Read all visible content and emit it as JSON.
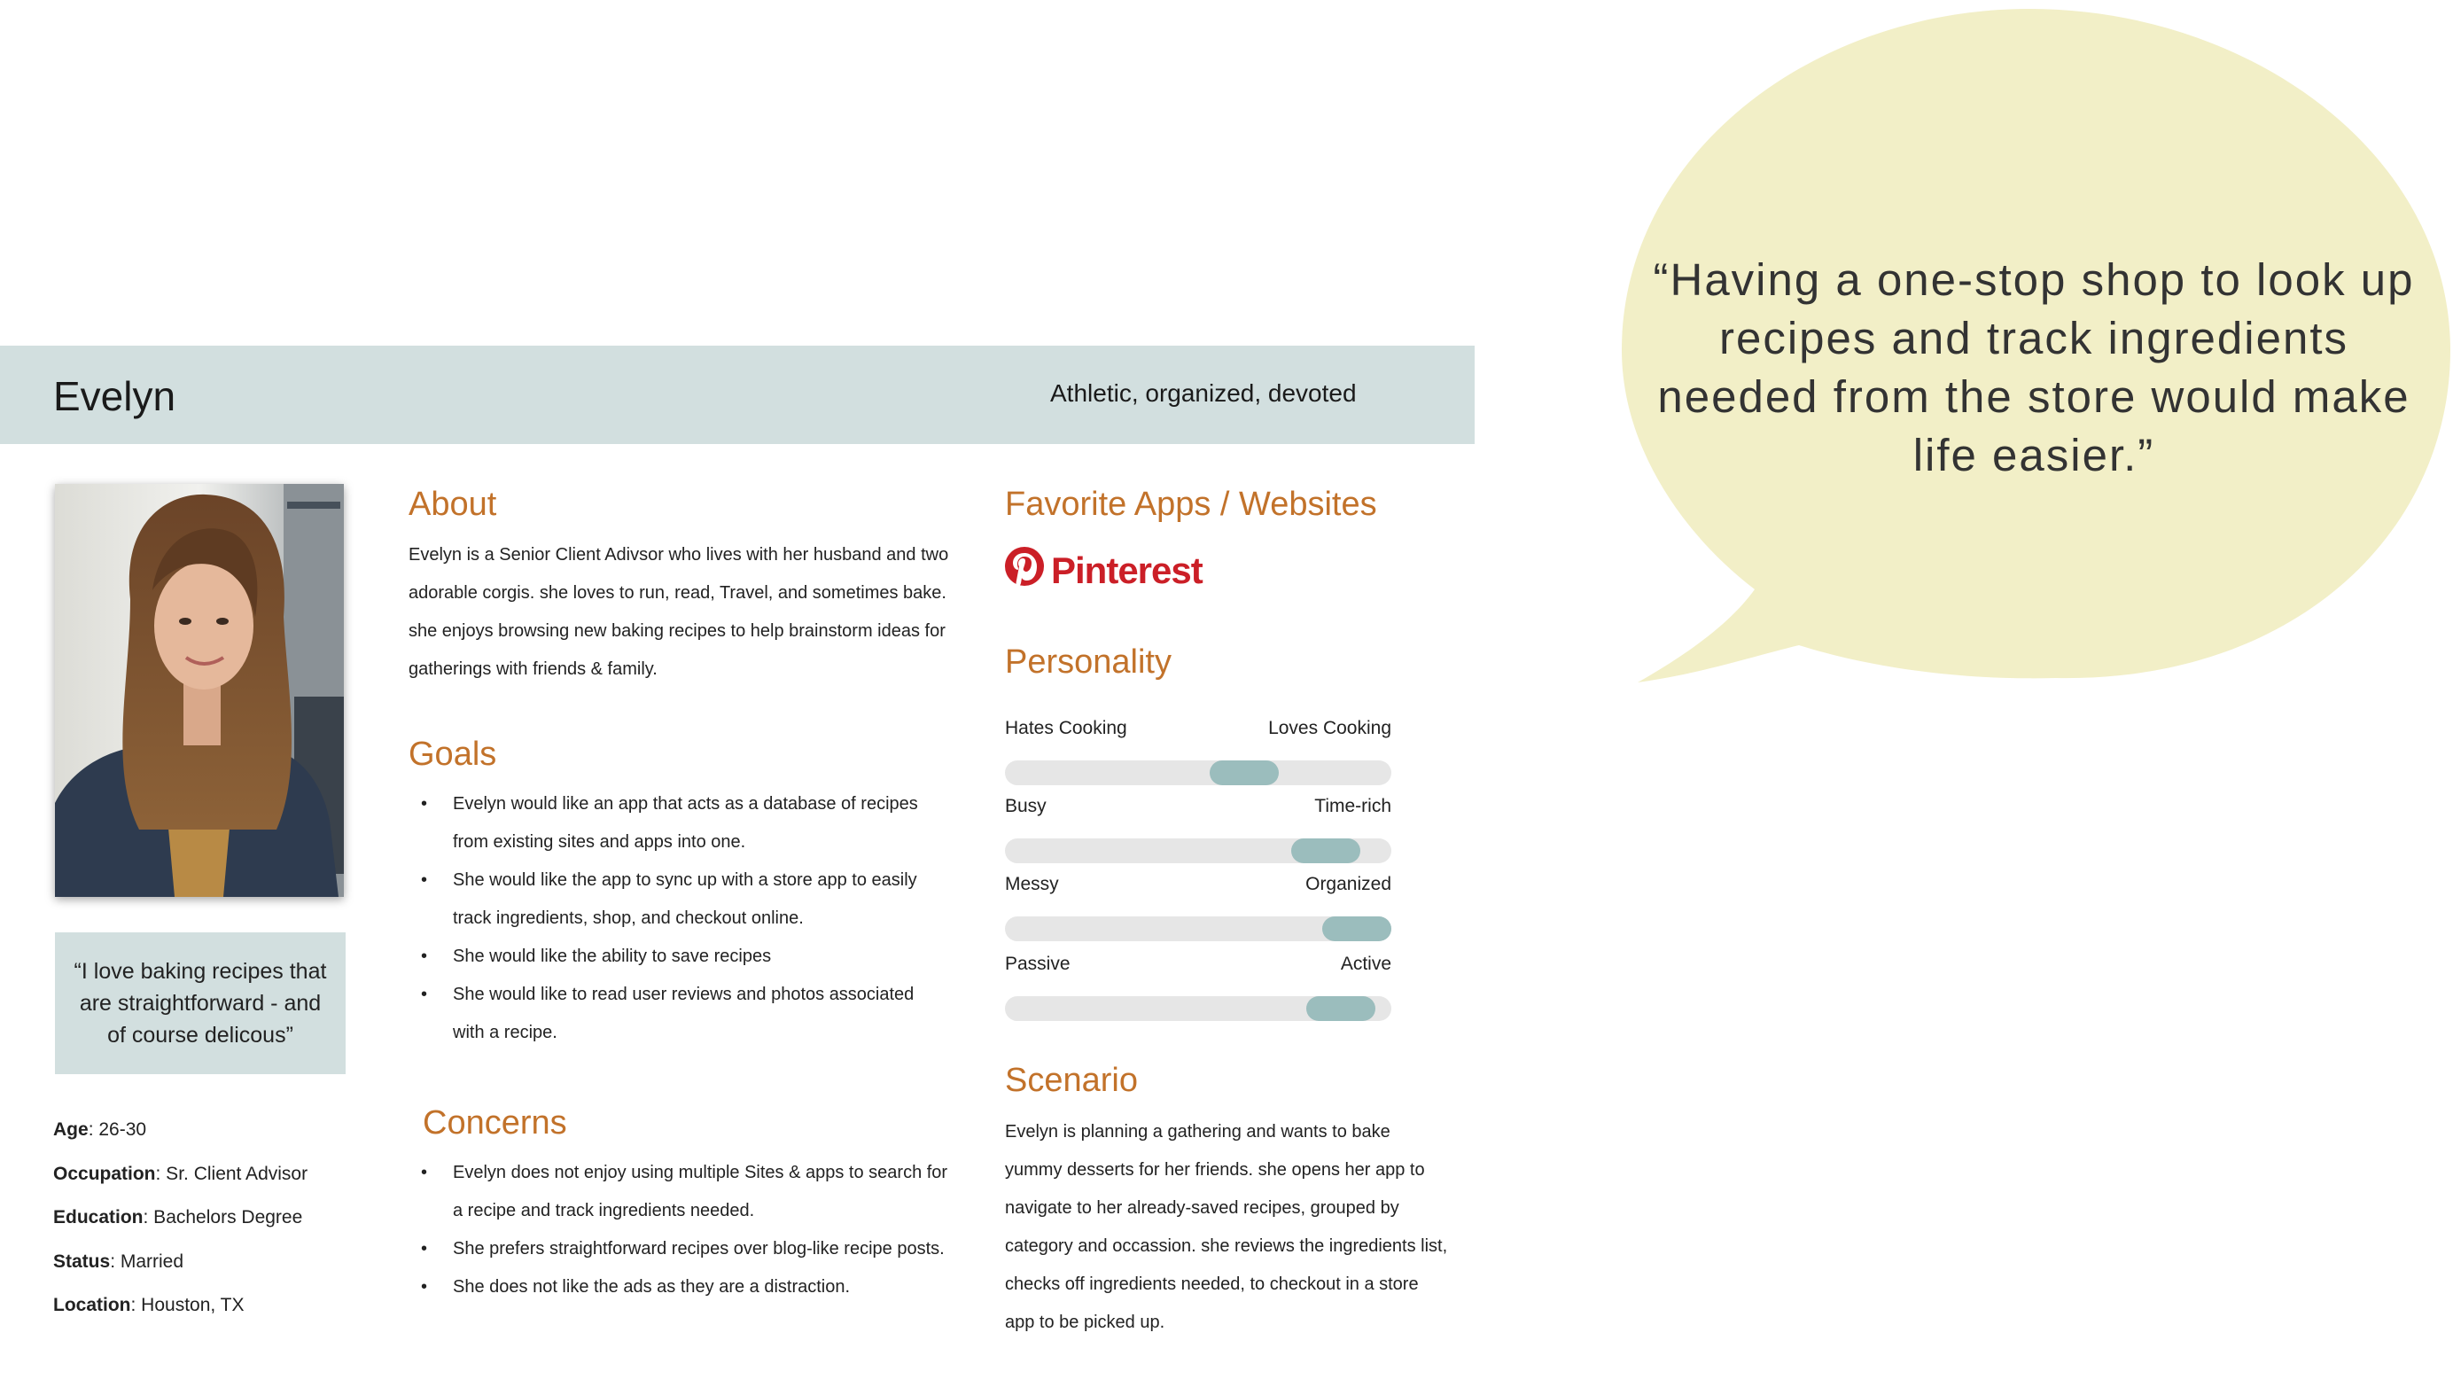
{
  "bubble_quote": "“Having a one-stop shop to look up recipes and track ingredients needed from the store would make life easier.”",
  "header": {
    "name": "Evelyn",
    "tagline": "Athletic, organized, devoted"
  },
  "photo_icon": "persona-portrait",
  "quote": "“I love baking recipes that are straightforward - and of course delicous”",
  "facts": [
    {
      "label": "Age",
      "value": ": 26-30"
    },
    {
      "label": "Occupation",
      "value": ": Sr. Client Advisor"
    },
    {
      "label": "Education",
      "value": ": Bachelors Degree"
    },
    {
      "label": "Status",
      "value": ": Married"
    },
    {
      "label": "Location",
      "value": ": Houston, TX"
    }
  ],
  "about": {
    "title": "About",
    "text": "Evelyn is a Senior Client Adivsor who lives with her husband and two adorable corgis.  she loves to run, read, Travel, and sometimes bake. she enjoys browsing new baking recipes to help brainstorm ideas for gatherings with friends & family."
  },
  "goals": {
    "title": "Goals",
    "items": [
      "Evelyn would like an app that acts as a database of recipes from existing sites and apps into one.",
      "She would like the app to sync up with a store app to easily track ingredients, shop, and checkout online.",
      "She would like the ability to save recipes",
      "She would like to read user reviews and photos associated with a recipe."
    ]
  },
  "concerns": {
    "title": "Concerns",
    "items": [
      "Evelyn does not enjoy using multiple Sites & apps to search for a recipe and track ingredients needed.",
      "She prefers straightforward recipes over blog-like recipe posts.",
      "She does not like the ads as they are a distraction."
    ]
  },
  "favorites": {
    "title": "Favorite Apps / Websites",
    "logo_text": "Pinterest",
    "logo_icon": "pinterest-logo",
    "brand_color": "#cb1f27"
  },
  "personality": {
    "title": "Personality",
    "traits": [
      {
        "left": "Hates Cooking",
        "right": "Loves Cooking",
        "level": 0.62
      },
      {
        "left": "Busy",
        "right": "Time-rich",
        "level": 0.83
      },
      {
        "left": "Messy",
        "right": "Organized",
        "level": 0.93
      },
      {
        "left": "Passive",
        "right": "Active",
        "level": 0.87
      }
    ]
  },
  "scenario": {
    "title": "Scenario",
    "text": "Evelyn is planning a gathering and wants to bake yummy desserts for her friends. she opens her app to navigate to her already-saved recipes, grouped by category and occassion. she reviews the ingredients list, checks off ingredients needed, to checkout in a store app to be picked up."
  },
  "colors": {
    "accent": "#c2722a",
    "header_band": "#d2dfdf",
    "bubble": "#f2efc7",
    "slider_knob": "#9bbdbd",
    "slider_track": "#e6e6e6"
  }
}
